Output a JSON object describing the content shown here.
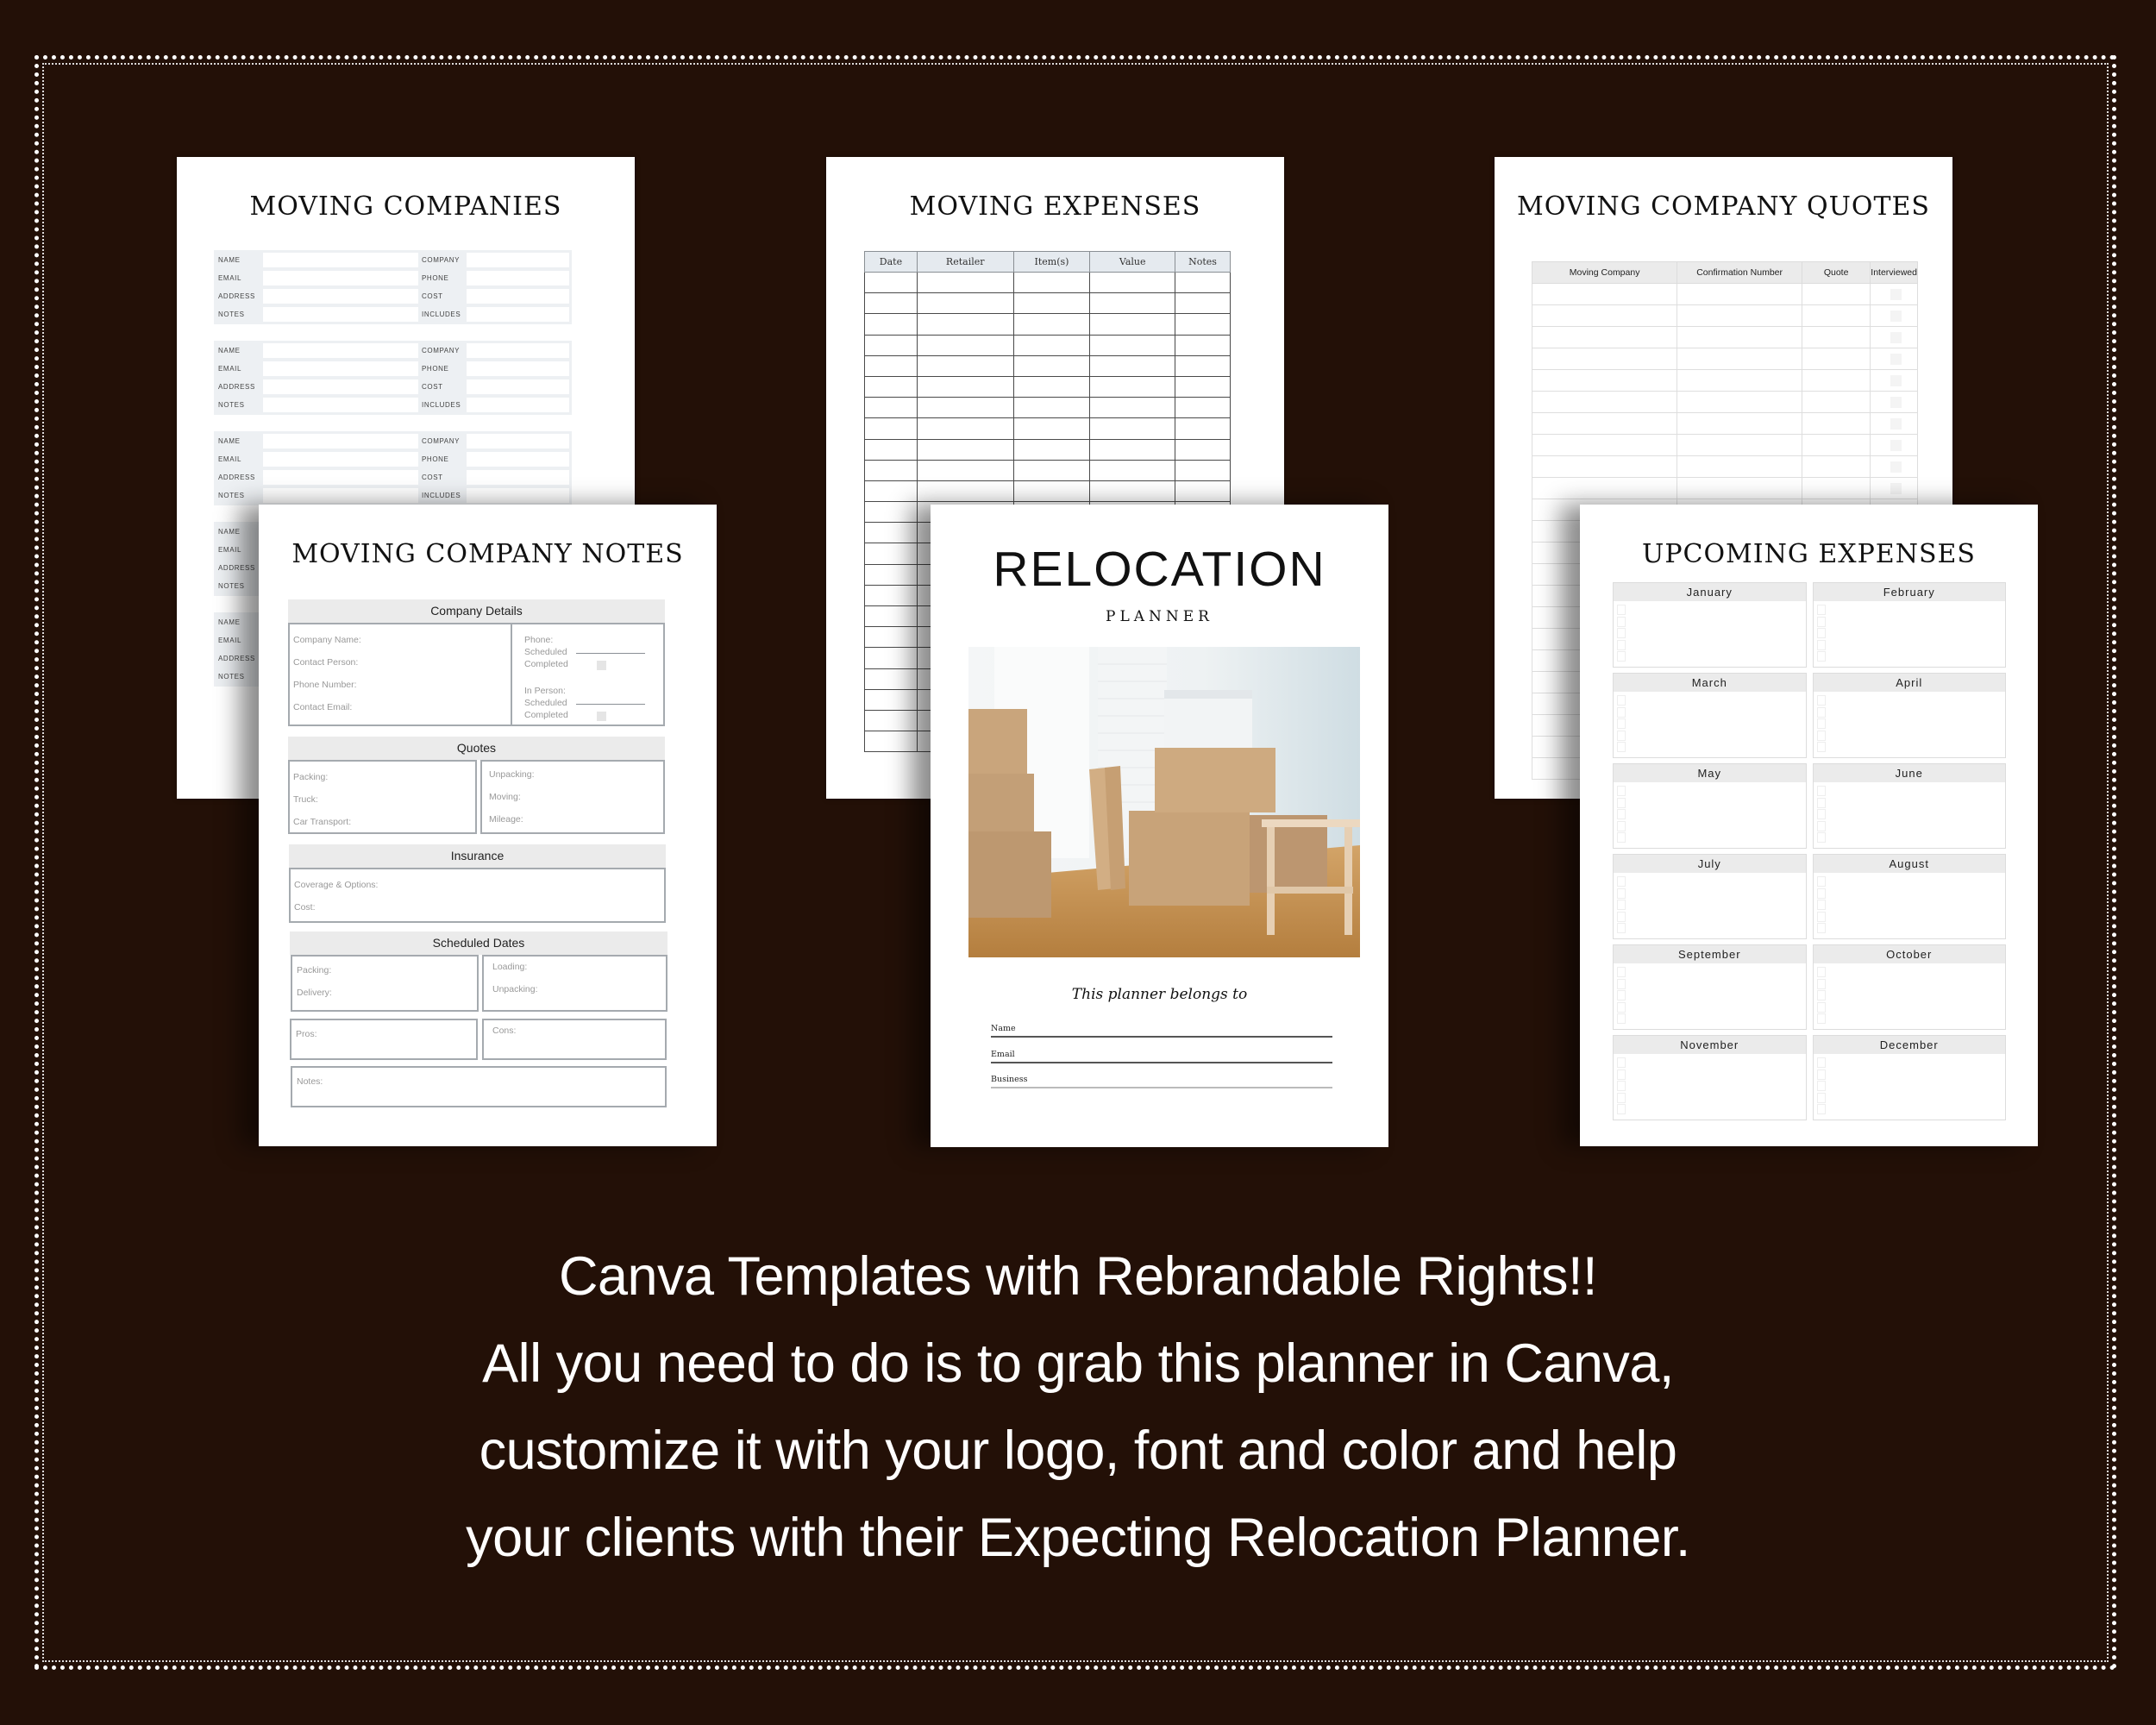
{
  "colors": {
    "background": "#231007",
    "page": "#ffffff",
    "text_light": "#ffffff"
  },
  "pages": {
    "moving_companies": {
      "title": "MOVING COMPANIES",
      "left_labels": [
        "NAME",
        "EMAIL",
        "ADDRESS",
        "NOTES"
      ],
      "right_labels": [
        "COMPANY",
        "PHONE",
        "COST",
        "INCLUDES"
      ],
      "block_count": 5
    },
    "moving_expenses": {
      "title": "MOVING EXPENSES",
      "columns": [
        "Date",
        "Retailer",
        "Item(s)",
        "Value",
        "Notes"
      ],
      "row_count": 23
    },
    "moving_company_quotes": {
      "title": "MOVING COMPANY QUOTES",
      "columns": [
        "Moving Company",
        "Confirmation Number",
        "Quote",
        "Interviewed"
      ],
      "row_count": 23
    },
    "moving_company_notes": {
      "title": "MOVING COMPANY NOTES",
      "company_details": {
        "heading": "Company Details",
        "left_fields": [
          "Company Name:",
          "Contact Person:",
          "Phone Number:",
          "Contact Email:"
        ],
        "phone": {
          "label": "Phone:",
          "scheduled": "Scheduled",
          "completed": "Completed"
        },
        "in_person": {
          "label": "In Person:",
          "scheduled": "Scheduled",
          "completed": "Completed"
        }
      },
      "quotes": {
        "heading": "Quotes",
        "left_fields": [
          "Packing:",
          "Truck:",
          "Car Transport:"
        ],
        "right_fields": [
          "Unpacking:",
          "Moving:",
          "Mileage:"
        ]
      },
      "insurance": {
        "heading": "Insurance",
        "fields": [
          "Coverage & Options:",
          "Cost:"
        ]
      },
      "scheduled_dates": {
        "heading": "Scheduled Dates",
        "left_fields": [
          "Packing:",
          "Delivery:"
        ],
        "right_fields": [
          "Loading:",
          "Unpacking:"
        ]
      },
      "pros": "Pros:",
      "cons": "Cons:",
      "notes": "Notes:"
    },
    "relocation_cover": {
      "title": "RELOCATION",
      "subtitle": "PLANNER",
      "photo_alt": "moving-boxes-photo",
      "belongs_to": "This planner belongs to",
      "fields": [
        "Name",
        "Email",
        "Business"
      ]
    },
    "upcoming_expenses": {
      "title": "UPCOMING EXPENSES",
      "months": [
        "January",
        "February",
        "March",
        "April",
        "May",
        "June",
        "July",
        "August",
        "September",
        "October",
        "November",
        "December"
      ],
      "checkboxes_per_month": 5
    }
  },
  "copy": {
    "lines": [
      "Canva Templates with Rebrandable Rights!!",
      "All you need to do is to grab this planner in Canva,",
      "customize it with your logo, font and color and help",
      "your clients with their Expecting Relocation Planner."
    ]
  }
}
